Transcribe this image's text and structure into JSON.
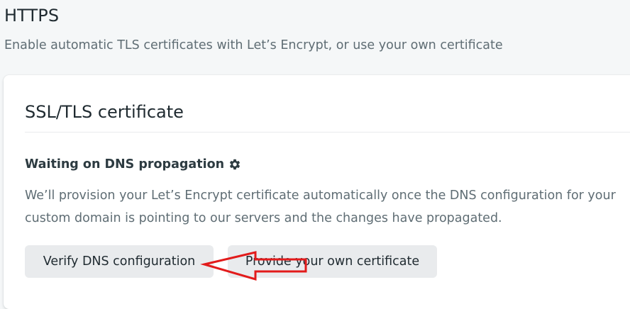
{
  "header": {
    "title": "HTTPS",
    "description": "Enable automatic TLS certificates with Let’s Encrypt, or use your own certificate"
  },
  "card": {
    "title": "SSL/TLS certificate",
    "status": {
      "title": "Waiting on DNS propagation",
      "icon": "gear-icon",
      "description": "We’ll provision your Let’s Encrypt certificate automatically once the DNS configuration for your custom domain is pointing to our servers and the changes have propagated."
    },
    "buttons": {
      "verify_label": "Verify DNS configuration",
      "provide_label": "Provide your own certificate"
    }
  },
  "annotation": {
    "arrow_color": "#e21b1b"
  },
  "colors": {
    "page_background": "#f5f7f8",
    "card_background": "#ffffff",
    "button_background": "#e9ebed",
    "text_primary": "#1f2a30",
    "text_secondary": "#5f6d74"
  }
}
